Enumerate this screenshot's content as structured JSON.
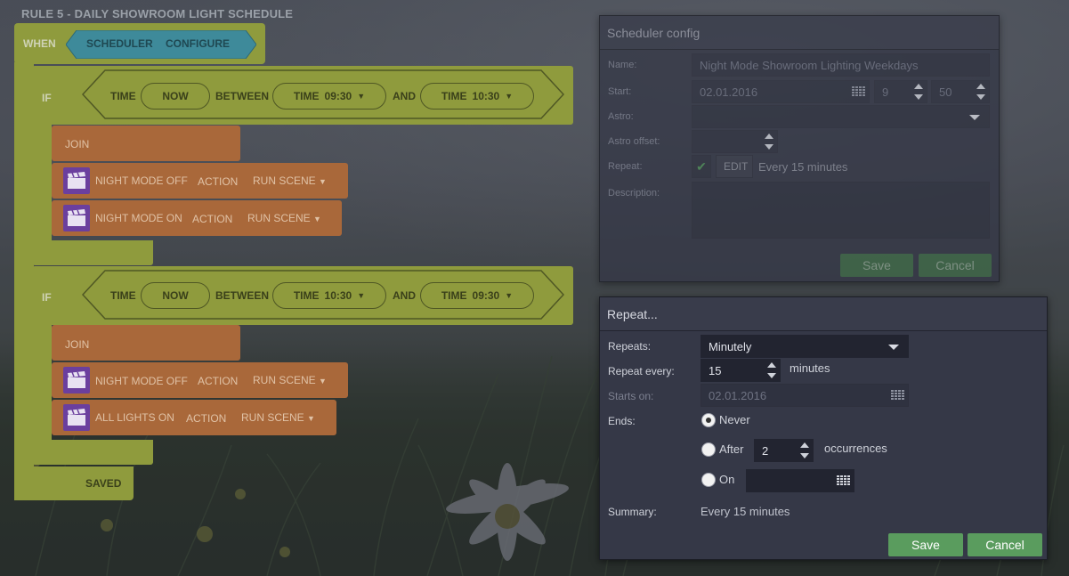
{
  "rule_title": "RULE 5 - DAILY SHOWROOM LIGHT SCHEDULE",
  "when_block": {
    "label": "WHEN",
    "scheduler": "SCHEDULER",
    "configure": "CONFIGURE"
  },
  "if_blocks": [
    {
      "if_label": "IF",
      "time_label": "TIME",
      "now": "NOW",
      "between": "BETWEEN",
      "time1_label": "TIME",
      "time1_value": "09:30",
      "and": "AND",
      "time2_label": "TIME",
      "time2_value": "10:30",
      "join": "JOIN",
      "actions": [
        {
          "name": "NIGHT MODE OFF",
          "action": "ACTION",
          "run": "RUN SCENE"
        },
        {
          "name": "NIGHT MODE ON",
          "action": "ACTION",
          "run": "RUN SCENE"
        }
      ]
    },
    {
      "if_label": "IF",
      "time_label": "TIME",
      "now": "NOW",
      "between": "BETWEEN",
      "time1_label": "TIME",
      "time1_value": "10:30",
      "and": "AND",
      "time2_label": "TIME",
      "time2_value": "09:30",
      "join": "JOIN",
      "actions": [
        {
          "name": "NIGHT MODE OFF",
          "action": "ACTION",
          "run": "RUN SCENE"
        },
        {
          "name": "ALL LIGHTS ON",
          "action": "ACTION",
          "run": "RUN SCENE"
        }
      ]
    }
  ],
  "saved_label": "SAVED",
  "scheduler_config": {
    "title": "Scheduler config",
    "name_label": "Name:",
    "name_value": "Night Mode  Showroom Lighting Weekdays",
    "start_label": "Start:",
    "start_date": "02.01.2016",
    "start_hour": "9",
    "start_minute": "50",
    "astro_label": "Astro:",
    "astro_value": "",
    "astro_offset_label": "Astro offset:",
    "astro_offset_value": "",
    "repeat_label": "Repeat:",
    "repeat_edit": "EDIT",
    "repeat_summary": "Every 15 minutes",
    "description_label": "Description:",
    "description_value": "",
    "save": "Save",
    "cancel": "Cancel"
  },
  "repeat_dialog": {
    "title": "Repeat...",
    "repeats_label": "Repeats:",
    "repeats_value": "Minutely",
    "repeat_every_label": "Repeat every:",
    "repeat_every_value": "15",
    "repeat_every_unit": "minutes",
    "starts_on_label": "Starts on:",
    "starts_on_value": "02.01.2016",
    "ends_label": "Ends:",
    "never": "Never",
    "after": "After",
    "after_value": "2",
    "occurrences": "occurrences",
    "on": "On",
    "on_value": "",
    "summary_label": "Summary:",
    "summary_value": "Every 15 minutes",
    "save": "Save",
    "cancel": "Cancel"
  },
  "colors": {
    "block_green": "#8f9b3d",
    "block_orange": "#a9683a",
    "block_cyan": "#3e8a9a",
    "scene_purple": "#6b3f9e",
    "dialog_bg": "#353847",
    "button_green": "#5a9c5e"
  }
}
